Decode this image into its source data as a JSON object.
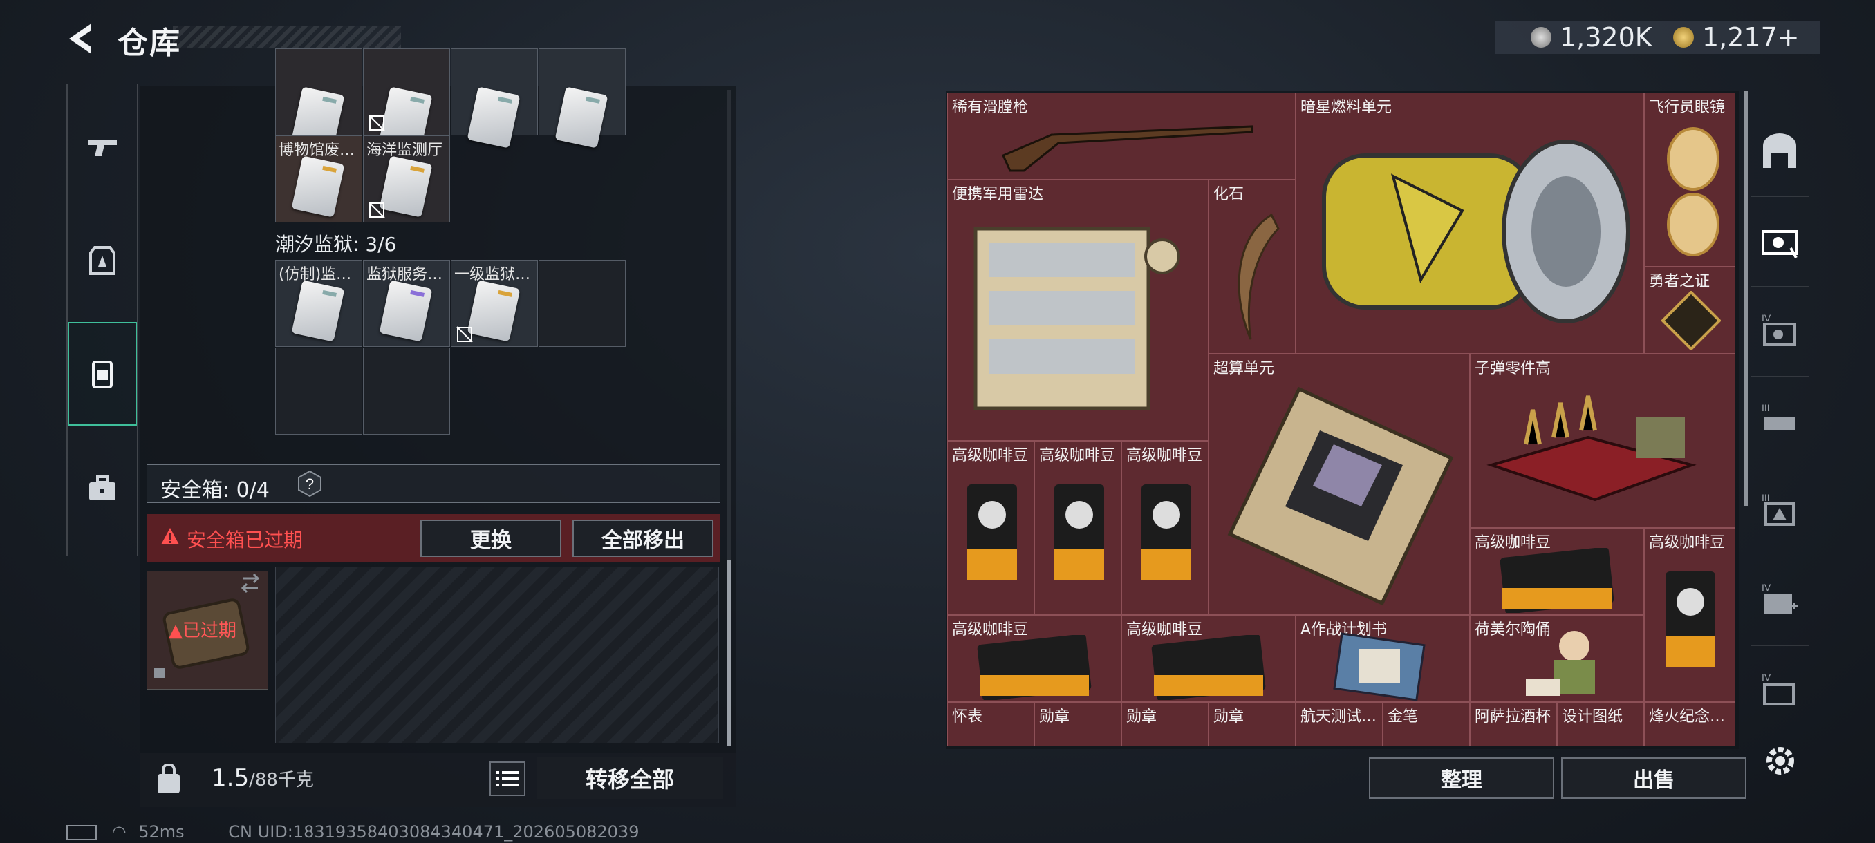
{
  "header": {
    "title": "仓库",
    "currency": [
      {
        "name": "silver-coin",
        "amount": "1,320K"
      },
      {
        "name": "gold-coin",
        "amount": "1,217+"
      }
    ]
  },
  "left_rail": {
    "items": [
      {
        "name": "weapon",
        "icon": "gun-icon"
      },
      {
        "name": "armor",
        "icon": "armor-icon"
      },
      {
        "name": "backpack",
        "icon": "backpack-icon",
        "active": true
      },
      {
        "name": "case",
        "icon": "briefcase-icon"
      }
    ]
  },
  "backpack": {
    "slots_top": [
      {
        "label": "博物馆废…"
      },
      {
        "label": "海洋监测厅"
      }
    ],
    "prison_label": "潮汐监狱: 3/6",
    "prison_slots": [
      {
        "label": "(仿制)监…"
      },
      {
        "label": "监狱服务…"
      },
      {
        "label": "一级监狱…"
      }
    ]
  },
  "safebox": {
    "label": "安全箱: 0/4",
    "help": "?",
    "expired_text": "安全箱已过期",
    "replace_button": "更换",
    "move_all_button": "全部移出",
    "case_expired": "已过期"
  },
  "bottom_left": {
    "weight_value": "1.5",
    "weight_unit": "/88千克",
    "transfer_all": "转移全部"
  },
  "stash": {
    "items": [
      {
        "label": "稀有滑膛枪"
      },
      {
        "label": "暗星燃料单元"
      },
      {
        "label": "飞行员眼镜"
      },
      {
        "label": "便携军用雷达"
      },
      {
        "label": "化石"
      },
      {
        "label": "勇者之证"
      },
      {
        "label": "超算单元"
      },
      {
        "label": "子弹零件高"
      },
      {
        "label": "高级咖啡豆"
      },
      {
        "label": "高级咖啡豆"
      },
      {
        "label": "高级咖啡豆"
      },
      {
        "label": "高级咖啡豆"
      },
      {
        "label": "高级咖啡豆"
      },
      {
        "label": "高级咖啡豆"
      },
      {
        "label": "高级咖啡豆"
      },
      {
        "label": "A作战计划书"
      },
      {
        "label": "荷美尔陶俑"
      },
      {
        "label": "怀表"
      },
      {
        "label": "勋章"
      },
      {
        "label": "勋章"
      },
      {
        "label": "勋章"
      },
      {
        "label": "航天测试…"
      },
      {
        "label": "金笔"
      },
      {
        "label": "阿萨拉酒杯"
      },
      {
        "label": "设计图纸"
      },
      {
        "label": "烽火纪念…"
      }
    ],
    "sort_button": "整理",
    "sell_button": "出售"
  },
  "right_rail": {
    "items": [
      {
        "icon": "vault-icon"
      },
      {
        "icon": "stash-tab-icon"
      },
      {
        "icon": "stash-tab-IV-icon",
        "level": "IV"
      },
      {
        "icon": "stash-tab-III-icon",
        "level": "III"
      },
      {
        "icon": "stash-tab-III-b-icon",
        "level": "III"
      },
      {
        "icon": "stash-tab-IV-b-icon",
        "level": "IV"
      },
      {
        "icon": "stash-tab-IV-c-icon",
        "level": "IV"
      }
    ]
  },
  "status": {
    "ping": "52ms",
    "uid": "CN UID:18319358403084340471_202605082039"
  },
  "colors": {
    "accent": "#3fbf9b",
    "warning": "#ff5050",
    "stash_bg": "#6a2a30"
  }
}
